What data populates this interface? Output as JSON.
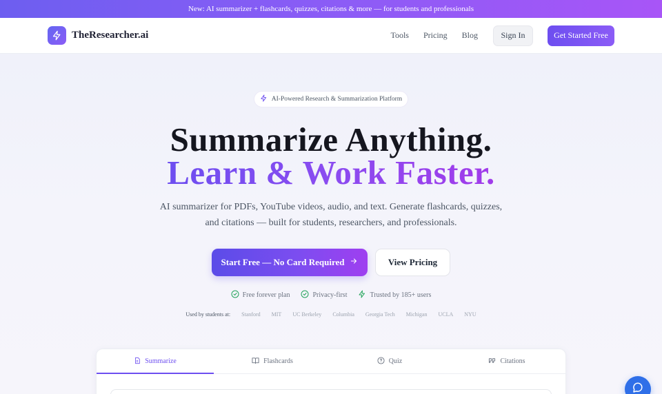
{
  "banner": {
    "text": "New: AI summarizer + flashcards, quizzes, citations & more — for students and professionals"
  },
  "nav": {
    "brand": "TheResearcher.ai",
    "links": [
      "Tools",
      "Pricing",
      "Blog"
    ],
    "sign_in": "Sign In",
    "get_started": "Get Started Free"
  },
  "hero": {
    "pill": "AI-Powered Research & Summarization Platform",
    "headline_1": "Summarize Anything.",
    "headline_2": "Learn & Work Faster.",
    "subtitle": "AI summarizer for PDFs, YouTube videos, audio, and text. Generate flashcards, quizzes, and citations — built for students, researchers, and professionals.",
    "cta_primary": "Start Free — No Card Required",
    "cta_secondary": "View Pricing"
  },
  "trust": [
    {
      "label": "Free forever plan",
      "icon": "check-circle-icon"
    },
    {
      "label": "Privacy-first",
      "icon": "check-circle-icon"
    },
    {
      "label": "Trusted by 185+ users",
      "icon": "bolt-icon"
    }
  ],
  "used_by": {
    "label": "Used by students at:",
    "schools": [
      "Stanford",
      "MIT",
      "UC Berkeley",
      "Columbia",
      "Georgia Tech",
      "Michigan",
      "UCLA",
      "NYU"
    ]
  },
  "tabs": [
    {
      "label": "Summarize",
      "icon": "document-icon",
      "active": true
    },
    {
      "label": "Flashcards",
      "icon": "book-icon",
      "active": false
    },
    {
      "label": "Quiz",
      "icon": "question-circle-icon",
      "active": false
    },
    {
      "label": "Citations",
      "icon": "quote-icon",
      "active": false
    }
  ],
  "colors": {
    "accent": "#6d4ef0",
    "accent_end": "#a855f7",
    "success": "#22a35a",
    "chat": "#2f6fe8"
  }
}
